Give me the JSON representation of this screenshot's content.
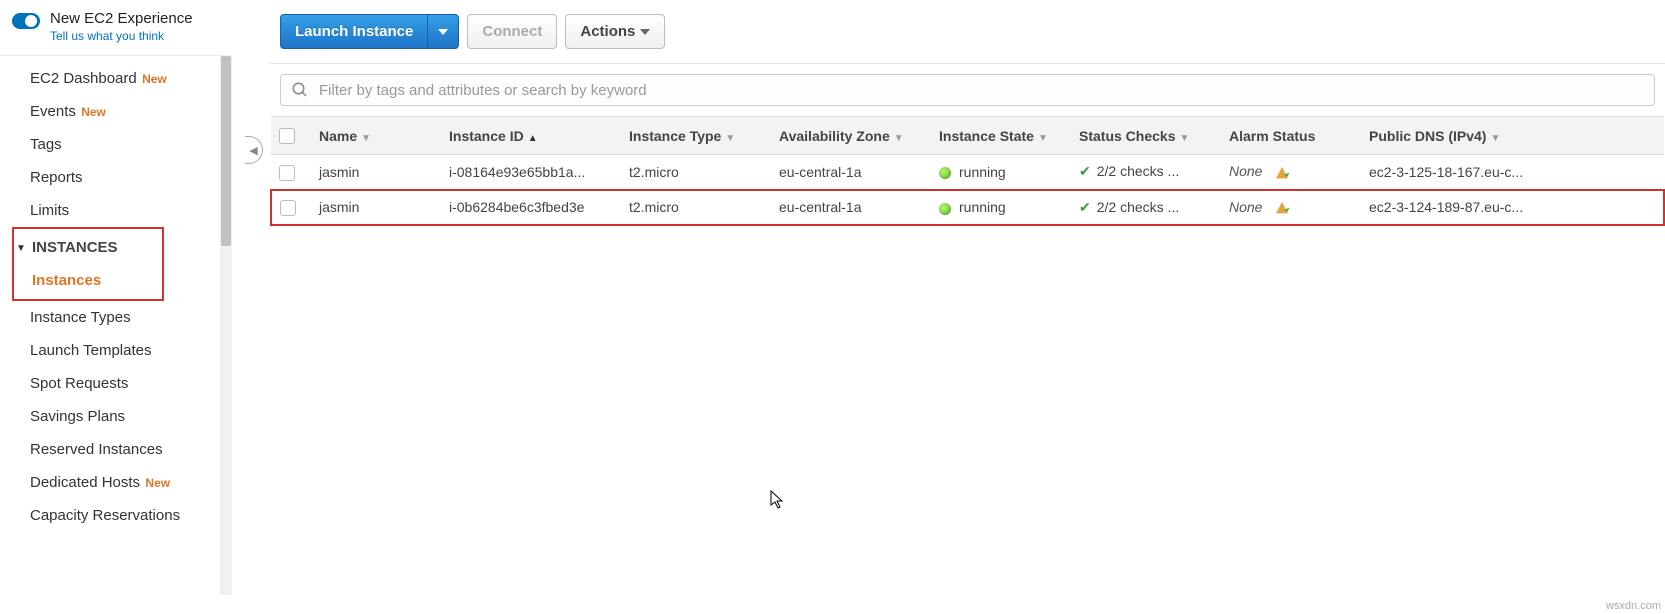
{
  "header": {
    "new_experience_title": "New EC2 Experience",
    "new_experience_sub": "Tell us what you think"
  },
  "sidebar": {
    "items": [
      {
        "label": "EC2 Dashboard",
        "badge": "New"
      },
      {
        "label": "Events",
        "badge": "New"
      },
      {
        "label": "Tags"
      },
      {
        "label": "Reports"
      },
      {
        "label": "Limits"
      }
    ],
    "section_instances": "INSTANCES",
    "instances_items": [
      {
        "label": "Instances",
        "active": true
      },
      {
        "label": "Instance Types"
      },
      {
        "label": "Launch Templates"
      },
      {
        "label": "Spot Requests"
      },
      {
        "label": "Savings Plans"
      },
      {
        "label": "Reserved Instances"
      },
      {
        "label": "Dedicated Hosts",
        "badge": "New"
      },
      {
        "label": "Capacity Reservations"
      }
    ]
  },
  "toolbar": {
    "launch_label": "Launch Instance",
    "connect_label": "Connect",
    "actions_label": "Actions"
  },
  "search": {
    "placeholder": "Filter by tags and attributes or search by keyword"
  },
  "columns": {
    "name": "Name",
    "instance_id": "Instance ID",
    "instance_type": "Instance Type",
    "az": "Availability Zone",
    "state": "Instance State",
    "status_checks": "Status Checks",
    "alarm_status": "Alarm Status",
    "public_dns": "Public DNS (IPv4)"
  },
  "rows": [
    {
      "name": "jasmin",
      "instance_id": "i-08164e93e65bb1a...",
      "instance_type": "t2.micro",
      "az": "eu-central-1a",
      "state": "running",
      "status_checks": "2/2 checks ...",
      "alarm_status": "None",
      "public_dns": "ec2-3-125-18-167.eu-c...",
      "highlighted": false
    },
    {
      "name": "jasmin",
      "instance_id": "i-0b6284be6c3fbed3e",
      "instance_type": "t2.micro",
      "az": "eu-central-1a",
      "state": "running",
      "status_checks": "2/2 checks ...",
      "alarm_status": "None",
      "public_dns": "ec2-3-124-189-87.eu-c...",
      "highlighted": true
    }
  ],
  "watermark": "wsxdn.com"
}
